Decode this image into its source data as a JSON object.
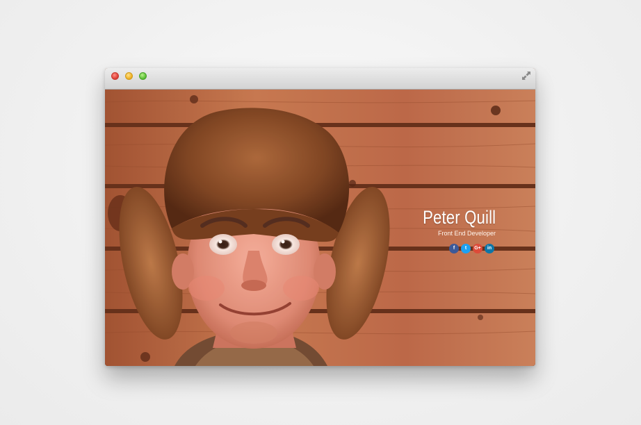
{
  "profile": {
    "name": "Peter Quill",
    "role": "Front End Developer"
  },
  "social": [
    {
      "icon": "facebook-icon",
      "glyph": "f",
      "color": "#3b5998"
    },
    {
      "icon": "twitter-icon",
      "glyph": "t",
      "color": "#1da1f2"
    },
    {
      "icon": "google-plus-icon",
      "glyph": "G+",
      "color": "#dd4b39"
    },
    {
      "icon": "linkedin-icon",
      "glyph": "in",
      "color": "#0e76a8"
    }
  ],
  "colors": {
    "wood": "#b86a44",
    "wood_dark": "#6a3420",
    "titlebar": "#dcdcdc"
  }
}
